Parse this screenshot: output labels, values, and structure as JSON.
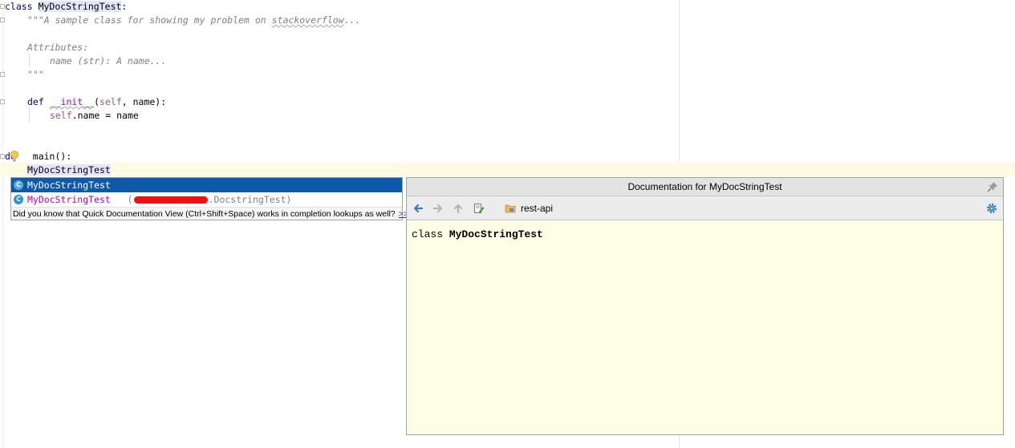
{
  "editor": {
    "line1_kw": "class",
    "line1_name": "MyDocStringTest",
    "line1_colon": ":",
    "line2_doc_a": "\"\"\"A sample class for showing my problem on ",
    "line2_doc_b": "stackoverflow",
    "line2_doc_c": "...",
    "line4_doc": "Attributes:",
    "line5_doc": "name (str): A name...",
    "line6_doc": "\"\"\"",
    "line8_kw": "def",
    "line8_magic": "__init__",
    "line8_paren_open": "(",
    "line8_self": "self",
    "line8_rest": ", name):",
    "line9_self": "self",
    "line9_rest": ".name = name",
    "line12_kw": "de",
    "line12_rest": " main():",
    "line13_text": "MyDocStringTest"
  },
  "completion": {
    "items": [
      {
        "label": "MyDocStringTest",
        "icon": "C"
      },
      {
        "label": "MyDocStringTest",
        "icon": "C",
        "location_open": "(",
        "location_suffix": ".DocstringTest)"
      }
    ],
    "hint": "Did you know that Quick Documentation View (Ctrl+Shift+Space) works in completion lookups as well?",
    "hint_link": ">>"
  },
  "doc_panel": {
    "title": "Documentation for MyDocStringTest",
    "module": "rest-api",
    "body_kw": "class",
    "body_name": "MyDocStringTest"
  },
  "colors": {
    "selection": "#0e5aa8",
    "doc_background": "#fefee4",
    "caret_row": "#fffae3",
    "keyword": "#000080",
    "docstring": "#808080",
    "magic": "#b200b2"
  }
}
